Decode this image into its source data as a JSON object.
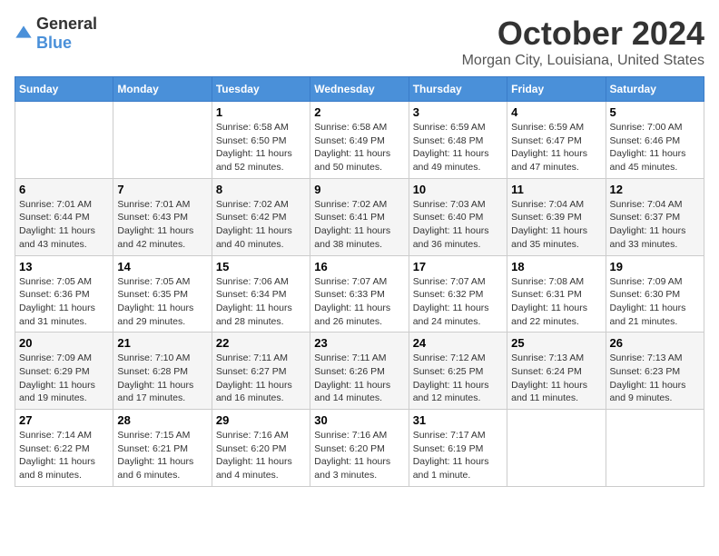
{
  "logo": {
    "text_general": "General",
    "text_blue": "Blue"
  },
  "title": "October 2024",
  "location": "Morgan City, Louisiana, United States",
  "days_of_week": [
    "Sunday",
    "Monday",
    "Tuesday",
    "Wednesday",
    "Thursday",
    "Friday",
    "Saturday"
  ],
  "weeks": [
    [
      {
        "day": "",
        "info": ""
      },
      {
        "day": "",
        "info": ""
      },
      {
        "day": "1",
        "info": "Sunrise: 6:58 AM\nSunset: 6:50 PM\nDaylight: 11 hours and 52 minutes."
      },
      {
        "day": "2",
        "info": "Sunrise: 6:58 AM\nSunset: 6:49 PM\nDaylight: 11 hours and 50 minutes."
      },
      {
        "day": "3",
        "info": "Sunrise: 6:59 AM\nSunset: 6:48 PM\nDaylight: 11 hours and 49 minutes."
      },
      {
        "day": "4",
        "info": "Sunrise: 6:59 AM\nSunset: 6:47 PM\nDaylight: 11 hours and 47 minutes."
      },
      {
        "day": "5",
        "info": "Sunrise: 7:00 AM\nSunset: 6:46 PM\nDaylight: 11 hours and 45 minutes."
      }
    ],
    [
      {
        "day": "6",
        "info": "Sunrise: 7:01 AM\nSunset: 6:44 PM\nDaylight: 11 hours and 43 minutes."
      },
      {
        "day": "7",
        "info": "Sunrise: 7:01 AM\nSunset: 6:43 PM\nDaylight: 11 hours and 42 minutes."
      },
      {
        "day": "8",
        "info": "Sunrise: 7:02 AM\nSunset: 6:42 PM\nDaylight: 11 hours and 40 minutes."
      },
      {
        "day": "9",
        "info": "Sunrise: 7:02 AM\nSunset: 6:41 PM\nDaylight: 11 hours and 38 minutes."
      },
      {
        "day": "10",
        "info": "Sunrise: 7:03 AM\nSunset: 6:40 PM\nDaylight: 11 hours and 36 minutes."
      },
      {
        "day": "11",
        "info": "Sunrise: 7:04 AM\nSunset: 6:39 PM\nDaylight: 11 hours and 35 minutes."
      },
      {
        "day": "12",
        "info": "Sunrise: 7:04 AM\nSunset: 6:37 PM\nDaylight: 11 hours and 33 minutes."
      }
    ],
    [
      {
        "day": "13",
        "info": "Sunrise: 7:05 AM\nSunset: 6:36 PM\nDaylight: 11 hours and 31 minutes."
      },
      {
        "day": "14",
        "info": "Sunrise: 7:05 AM\nSunset: 6:35 PM\nDaylight: 11 hours and 29 minutes."
      },
      {
        "day": "15",
        "info": "Sunrise: 7:06 AM\nSunset: 6:34 PM\nDaylight: 11 hours and 28 minutes."
      },
      {
        "day": "16",
        "info": "Sunrise: 7:07 AM\nSunset: 6:33 PM\nDaylight: 11 hours and 26 minutes."
      },
      {
        "day": "17",
        "info": "Sunrise: 7:07 AM\nSunset: 6:32 PM\nDaylight: 11 hours and 24 minutes."
      },
      {
        "day": "18",
        "info": "Sunrise: 7:08 AM\nSunset: 6:31 PM\nDaylight: 11 hours and 22 minutes."
      },
      {
        "day": "19",
        "info": "Sunrise: 7:09 AM\nSunset: 6:30 PM\nDaylight: 11 hours and 21 minutes."
      }
    ],
    [
      {
        "day": "20",
        "info": "Sunrise: 7:09 AM\nSunset: 6:29 PM\nDaylight: 11 hours and 19 minutes."
      },
      {
        "day": "21",
        "info": "Sunrise: 7:10 AM\nSunset: 6:28 PM\nDaylight: 11 hours and 17 minutes."
      },
      {
        "day": "22",
        "info": "Sunrise: 7:11 AM\nSunset: 6:27 PM\nDaylight: 11 hours and 16 minutes."
      },
      {
        "day": "23",
        "info": "Sunrise: 7:11 AM\nSunset: 6:26 PM\nDaylight: 11 hours and 14 minutes."
      },
      {
        "day": "24",
        "info": "Sunrise: 7:12 AM\nSunset: 6:25 PM\nDaylight: 11 hours and 12 minutes."
      },
      {
        "day": "25",
        "info": "Sunrise: 7:13 AM\nSunset: 6:24 PM\nDaylight: 11 hours and 11 minutes."
      },
      {
        "day": "26",
        "info": "Sunrise: 7:13 AM\nSunset: 6:23 PM\nDaylight: 11 hours and 9 minutes."
      }
    ],
    [
      {
        "day": "27",
        "info": "Sunrise: 7:14 AM\nSunset: 6:22 PM\nDaylight: 11 hours and 8 minutes."
      },
      {
        "day": "28",
        "info": "Sunrise: 7:15 AM\nSunset: 6:21 PM\nDaylight: 11 hours and 6 minutes."
      },
      {
        "day": "29",
        "info": "Sunrise: 7:16 AM\nSunset: 6:20 PM\nDaylight: 11 hours and 4 minutes."
      },
      {
        "day": "30",
        "info": "Sunrise: 7:16 AM\nSunset: 6:20 PM\nDaylight: 11 hours and 3 minutes."
      },
      {
        "day": "31",
        "info": "Sunrise: 7:17 AM\nSunset: 6:19 PM\nDaylight: 11 hours and 1 minute."
      },
      {
        "day": "",
        "info": ""
      },
      {
        "day": "",
        "info": ""
      }
    ]
  ]
}
